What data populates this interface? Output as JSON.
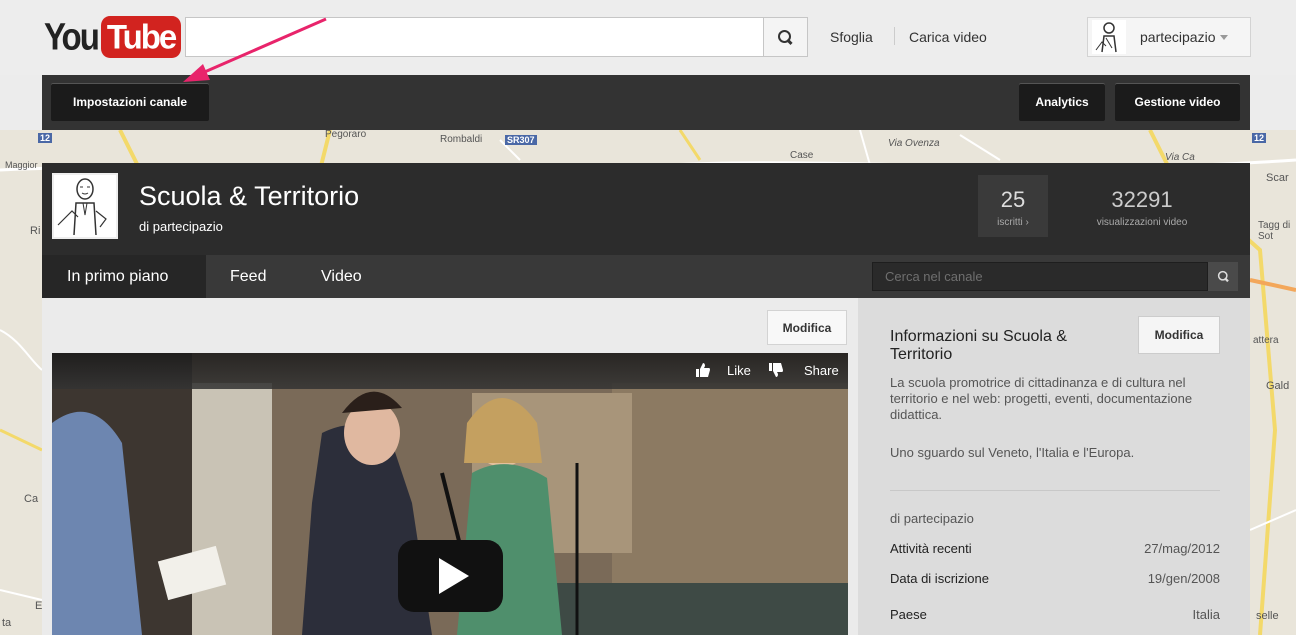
{
  "header": {
    "logo_you": "You",
    "logo_tube": "Tube",
    "search_placeholder": "",
    "browse_label": "Sfoglia",
    "upload_label": "Carica video",
    "username": "partecipazio"
  },
  "admin_bar": {
    "channel_settings": "Impostazioni canale",
    "analytics": "Analytics",
    "video_manager": "Gestione video"
  },
  "map_labels": [
    "Pegorarо",
    "Rombaldi",
    "SR307",
    "Case",
    "Via Ovenza",
    "Via Ca",
    "Maggior",
    "Scar",
    "Ri",
    "Tagg di Sot",
    "attera",
    "Gald",
    "Ca",
    "E",
    "ta",
    "selle",
    "12"
  ],
  "channel": {
    "title": "Scuola & Territorio",
    "by": "di partecipazio",
    "subscribers": "25",
    "subscribers_label": "iscritti ›",
    "views": "32291",
    "views_label": "visualizzazioni video",
    "tabs": [
      "In primo piano",
      "Feed",
      "Video"
    ],
    "search_placeholder": "Cerca nel canale"
  },
  "featured": {
    "edit_label": "Modifica",
    "like_label": "Like",
    "share_label": "Share"
  },
  "about": {
    "title": "Informazioni su Scuola & Territorio",
    "edit_label": "Modifica",
    "description": "La scuola promotrice di cittadinanza e di cultura nel territorio e nel web: progetti, eventi, documentazione didattica.",
    "description2": "Uno sguardo sul Veneto, l'Italia e l'Europa.",
    "by": "di partecipazio",
    "rows": [
      {
        "label": "Attività recenti",
        "value": "27/mag/2012"
      },
      {
        "label": "Data di iscrizione",
        "value": "19/gen/2008"
      },
      {
        "label": "Paese",
        "value": "Italia"
      }
    ]
  },
  "colors": {
    "brand_red": "#d2231f",
    "annotation_arrow": "#e8246b"
  }
}
